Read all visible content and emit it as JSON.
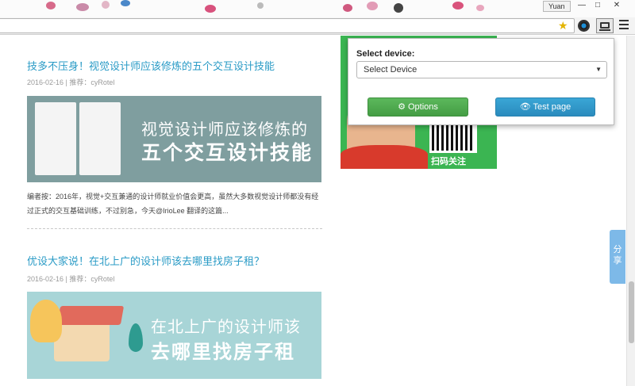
{
  "titlebar": {
    "user": "Yuan",
    "minimize": "—",
    "restore": "□",
    "close": "✕"
  },
  "extension_popup": {
    "select_label": "Select device:",
    "select_value": "Select Device",
    "options_label": "⚙ Options",
    "test_label": "👁 Test page"
  },
  "posts": [
    {
      "title": "技多不压身！视觉设计师应该修炼的五个交互设计技能",
      "meta": "2016-02-16 | 推荐：cyRotel",
      "banner_line1": "视觉设计师应该修炼的",
      "banner_line2": "五个交互设计技能",
      "excerpt": "编者按：2016年，视觉+交互兼通的设计师就业价值会更高，虽然大多数视觉设计师都没有经过正式的交互基础训练，不过别急，今天@IrioLee 翻译的这篇..."
    },
    {
      "title": "优设大家说！在北上广的设计师该去哪里找房子租？",
      "meta": "2016-02-16 | 推荐：cyRotel",
      "banner_line1": "在北上广的设计师该",
      "banner_line2": "去哪里找房子租"
    }
  ],
  "ad": {
    "qr_label": "扫码关注"
  },
  "share": {
    "label": "分享"
  },
  "colors": {
    "link": "#2a9bc6",
    "options_btn": "#5cb85c",
    "test_btn": "#3aa6d6",
    "share": "#7db9e8"
  }
}
